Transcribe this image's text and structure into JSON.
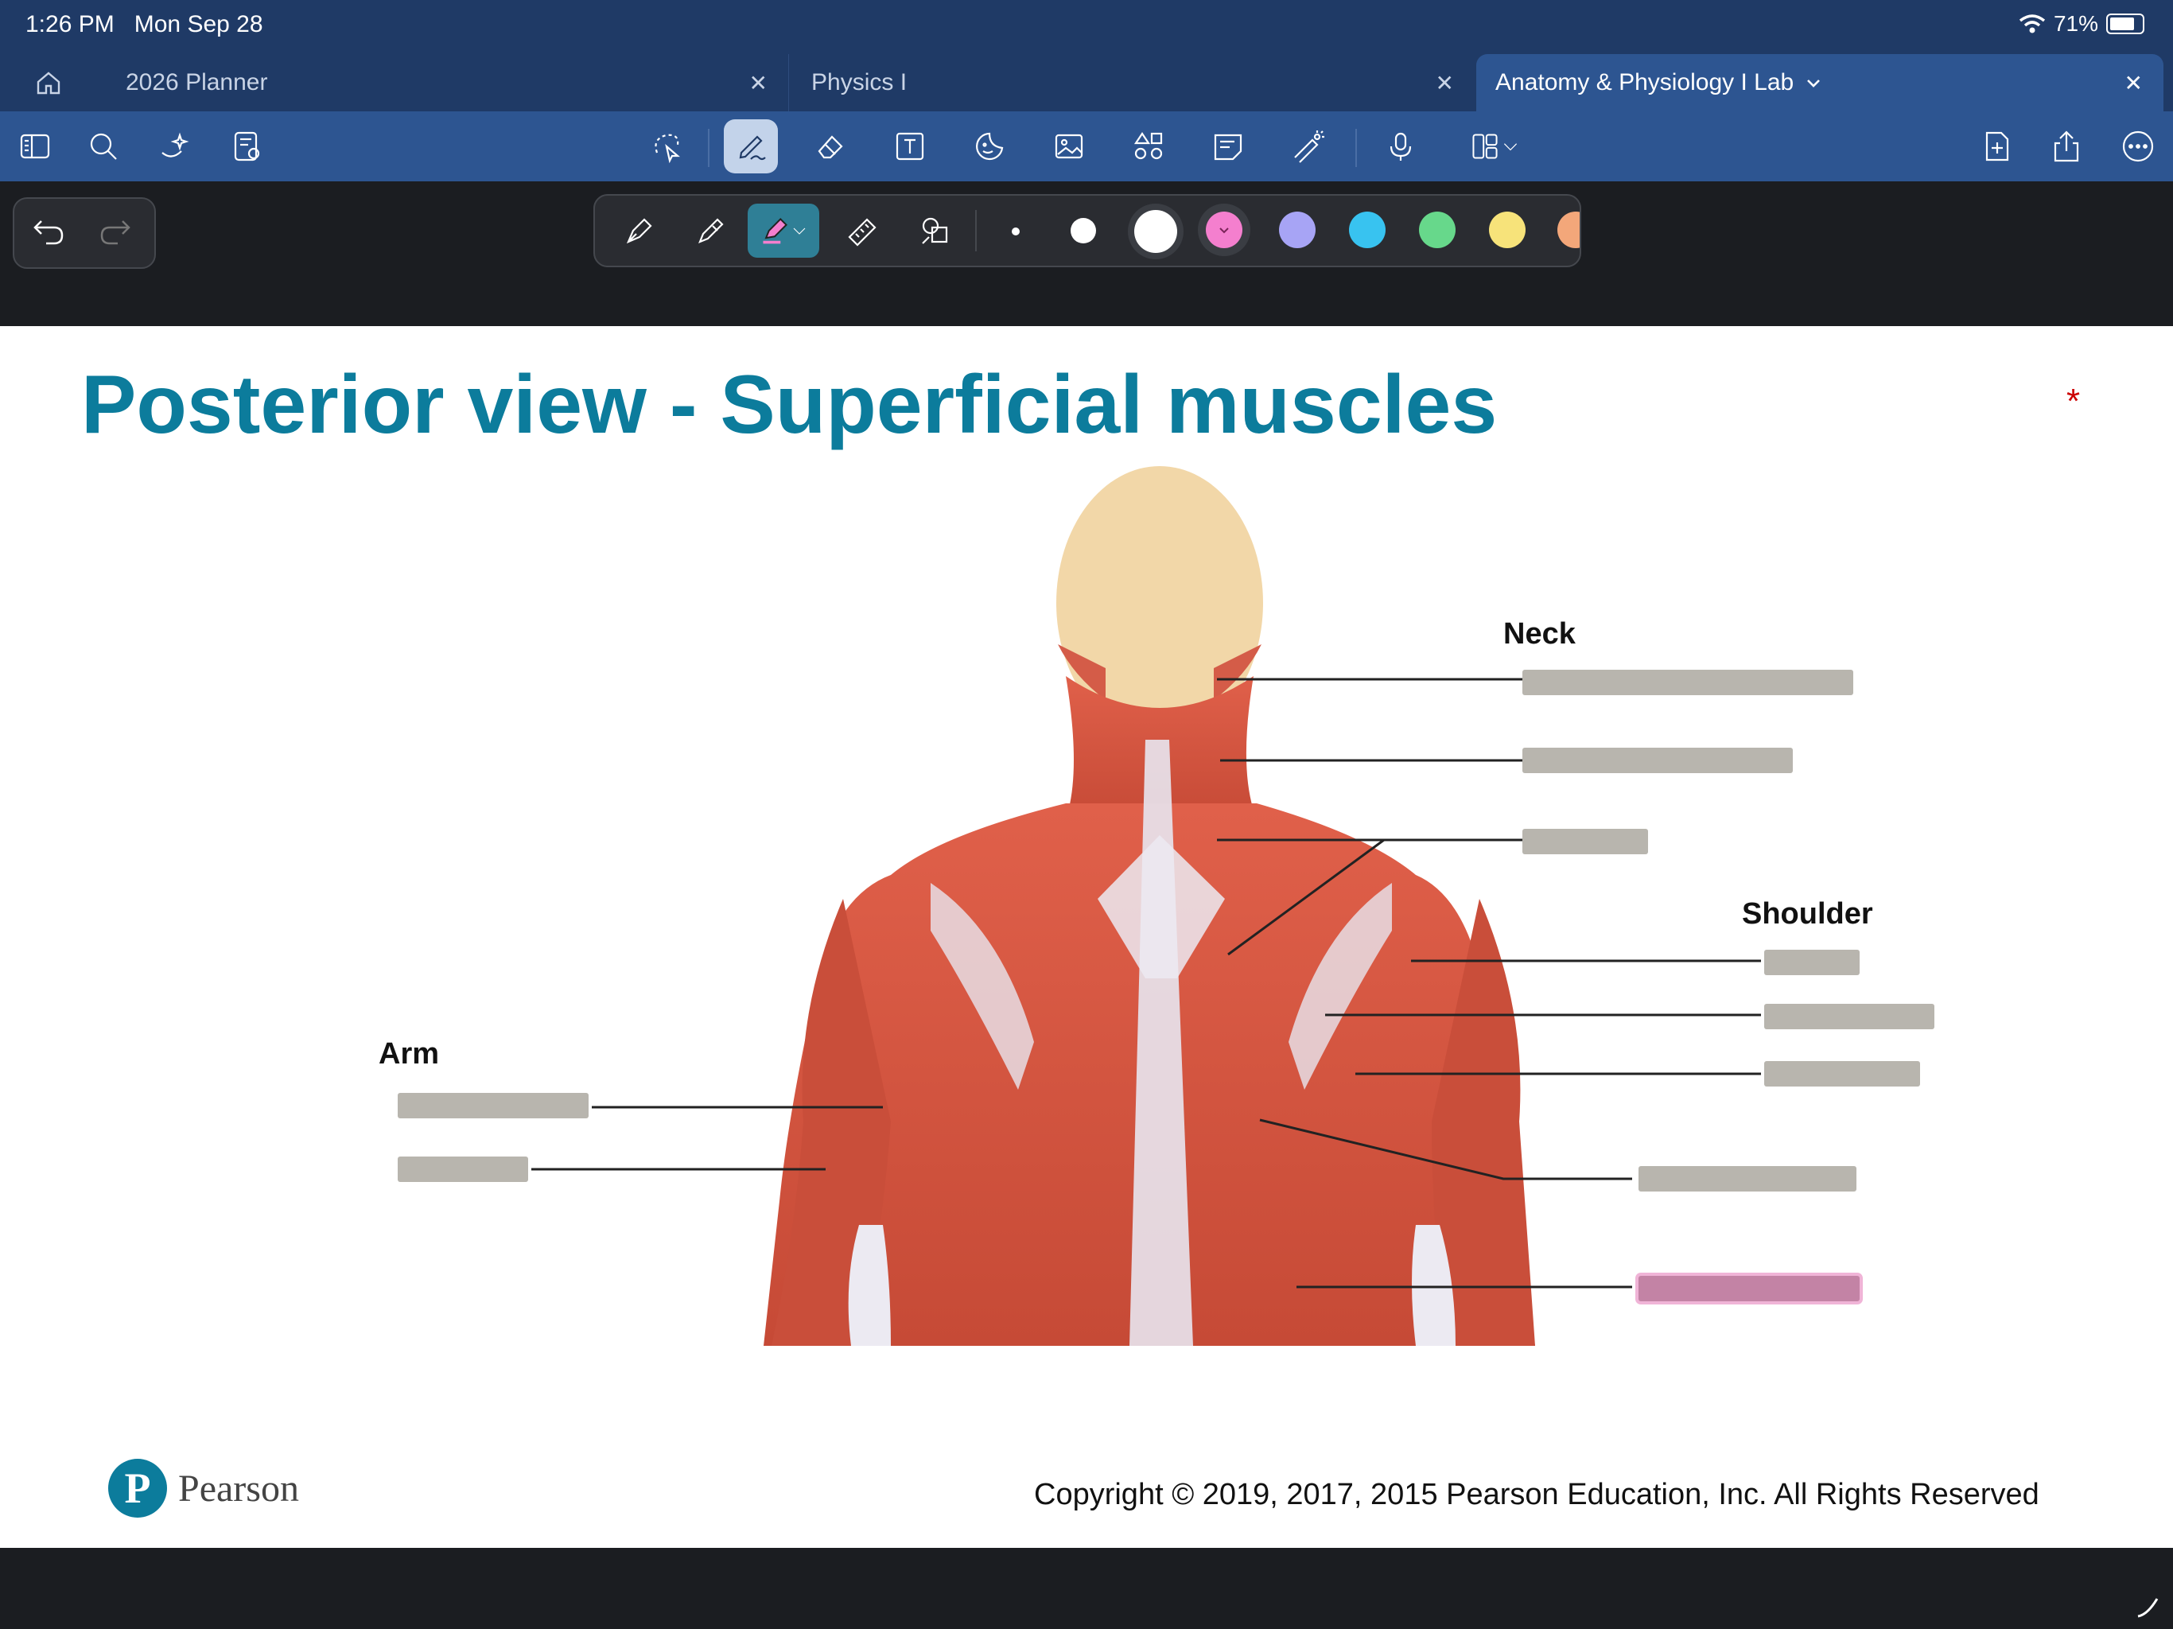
{
  "status_bar": {
    "time": "1:26 PM",
    "date": "Mon Sep 28",
    "battery": "71%",
    "battery_level": 0.71,
    "icons": [
      "wifi-icon",
      "battery-icon"
    ]
  },
  "tabs": [
    {
      "label": "2026 Planner"
    },
    {
      "label": "Physics I"
    },
    {
      "label": "Anatomy & Physiology I Lab",
      "active": true
    }
  ],
  "toolbar": {
    "left_icons": [
      "sidebar-icon",
      "search-icon",
      "ai-sparkle-icon",
      "page-settings-icon"
    ],
    "center_icons": [
      "lasso-icon",
      "pen-icon",
      "eraser-icon",
      "text-icon",
      "sticker-icon",
      "image-icon",
      "shapes-icon",
      "sticky-note-icon",
      "laser-pointer-icon",
      "microphone-icon",
      "more-tools-icon"
    ],
    "right_icons": [
      "add-page-icon",
      "share-icon",
      "more-icon"
    ]
  },
  "pen_tools": {
    "tools": [
      "fountain-pen-icon",
      "ball-pen-icon",
      "highlighter-icon",
      "ruler-icon",
      "shape-tool-icon"
    ],
    "sizes": [
      "small",
      "medium",
      "large"
    ],
    "colors": [
      "#f47fce",
      "#a7a4f5",
      "#38c3f0",
      "#67d88b",
      "#f7e37a",
      "#f3a77a"
    ]
  },
  "slide": {
    "title": "Posterior view - Superficial muscles",
    "marker": "*",
    "regions": {
      "neck": "Neck",
      "shoulder": "Shoulder",
      "arm": "Arm"
    },
    "copyright": "Copyright © 2019, 2017, 2015 Pearson Education, Inc. All Rights Reserved",
    "logo_text": "Pearson"
  }
}
